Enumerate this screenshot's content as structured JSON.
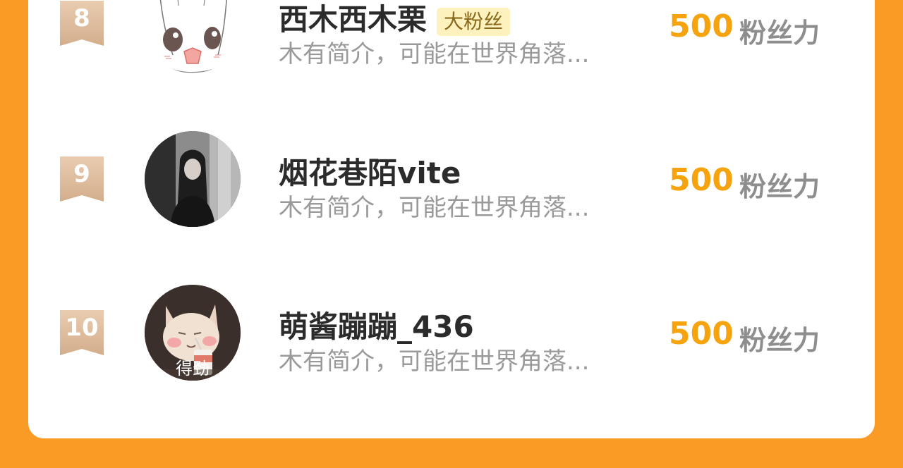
{
  "ranking": {
    "rows": [
      {
        "rank": "8",
        "name": "西木西木栗",
        "badge": "大粉丝",
        "description": "木有简介，可能在世界角落...",
        "score": "500",
        "score_unit": "粉丝力",
        "avatar": "anime-girl-sketch"
      },
      {
        "rank": "9",
        "name": "烟花巷陌vite",
        "description": "木有简介，可能在世界角落...",
        "score": "500",
        "score_unit": "粉丝力",
        "avatar": "girl-photo-grayscale"
      },
      {
        "rank": "10",
        "name": "萌酱蹦蹦_436",
        "description": "木有简介，可能在世界角落...",
        "score": "500",
        "score_unit": "粉丝力",
        "avatar": "cat-photo",
        "avatar_caption": "得劲"
      }
    ]
  },
  "colors": {
    "background": "#FA9B26",
    "score": "#F5A30E",
    "rank_badge": "#D3AE8C",
    "fan_badge_bg": "#FDF1BE"
  }
}
